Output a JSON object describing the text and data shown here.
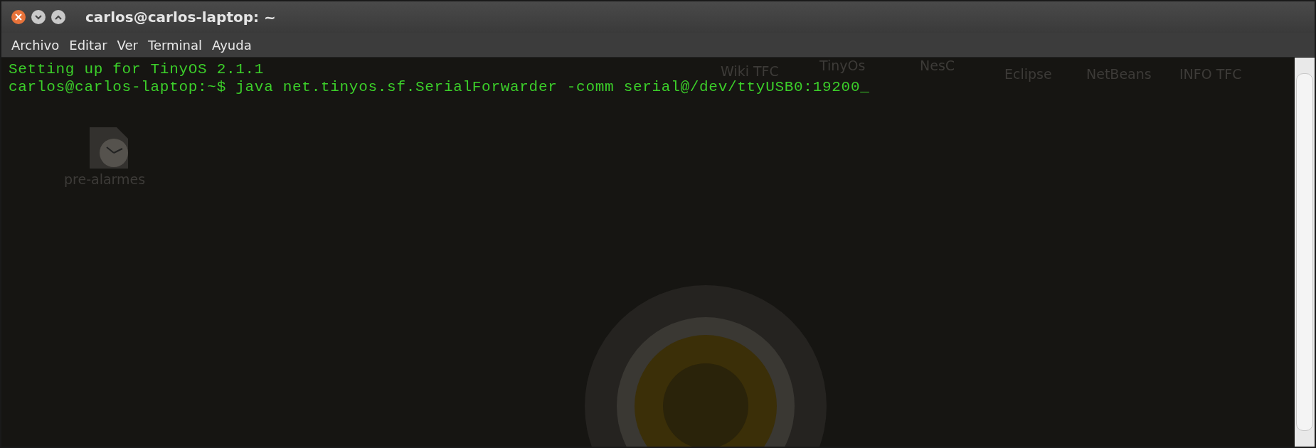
{
  "window": {
    "title": "carlos@carlos-laptop: ~"
  },
  "menu": [
    "Archivo",
    "Editar",
    "Ver",
    "Terminal",
    "Ayuda"
  ],
  "terminal": {
    "lines": [
      "Setting up for TinyOS 2.1.1",
      "carlos@carlos-laptop:~$ java net.tinyos.sf.SerialForwarder -comm serial@/dev/ttyUSB0:19200_"
    ]
  },
  "desktop_icons": [
    {
      "label": "Wiki TFC",
      "kind": "top"
    },
    {
      "label": "TinyOs",
      "kind": "top"
    },
    {
      "label": "NesC",
      "kind": "top"
    },
    {
      "label": "Eclipse",
      "kind": "top"
    },
    {
      "label": "NetBeans",
      "kind": "top"
    },
    {
      "label": "INFO TFC",
      "kind": "top"
    },
    {
      "label": "pre-alarmes",
      "kind": "clock"
    }
  ]
}
